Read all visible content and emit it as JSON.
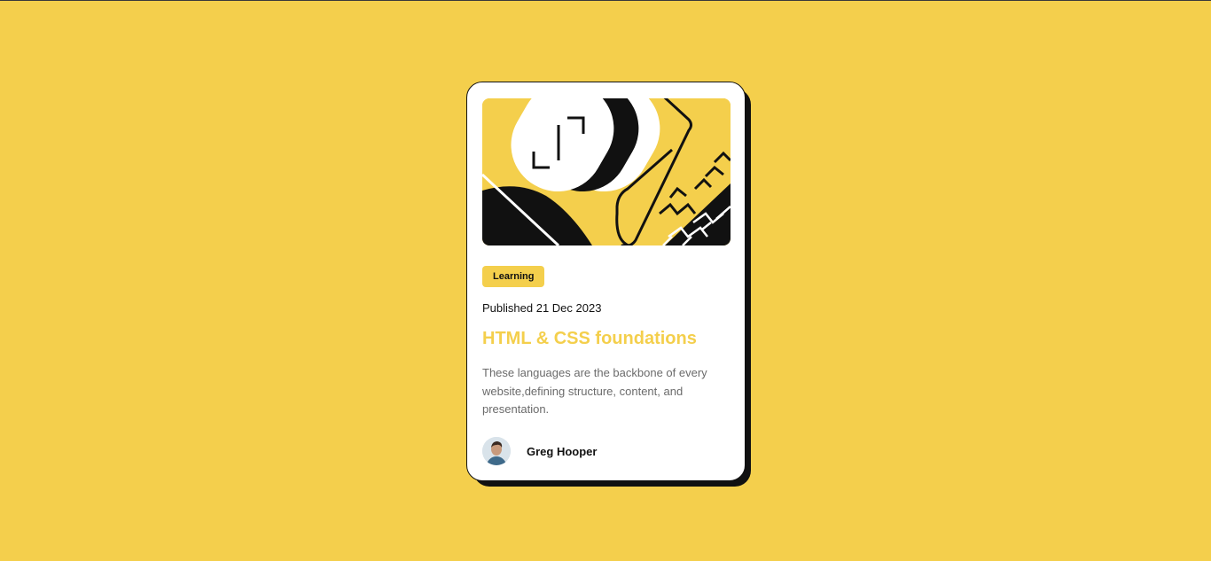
{
  "card": {
    "category": "Learning",
    "published": "Published 21 Dec 2023",
    "title": "HTML & CSS foundations",
    "description": "These languages are the backbone of every website,defining structure, content, and presentation.",
    "author": {
      "name": "Greg Hooper"
    }
  },
  "colors": {
    "background": "#F4CF4C",
    "accent": "#F4CF4C",
    "ink": "#111111",
    "card": "#FFFFFF",
    "muted_text": "#6B6B6B"
  },
  "icons": {
    "hero": "abstract-illustration",
    "avatar": "author-photo"
  }
}
